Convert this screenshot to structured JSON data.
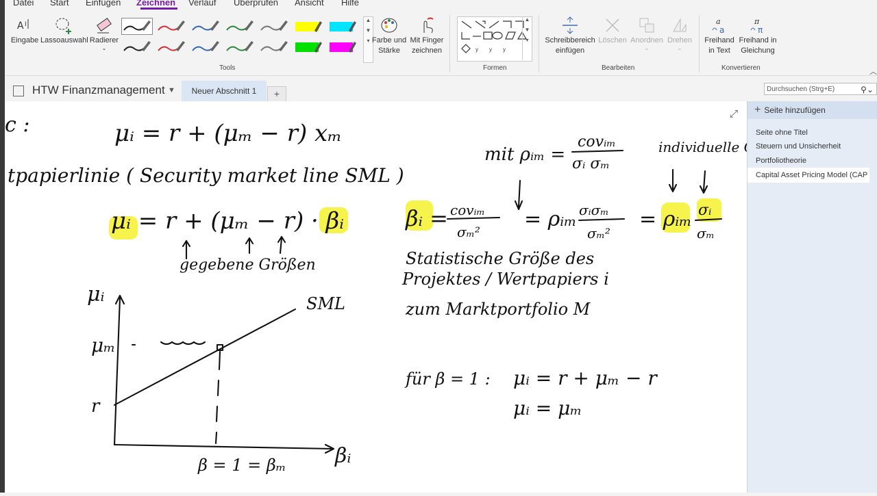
{
  "menu": [
    "Datei",
    "Start",
    "Einfügen",
    "Zeichnen",
    "Verlauf",
    "Überprüfen",
    "Ansicht",
    "Hilfe"
  ],
  "ribbon": {
    "eingabe": "Eingabe",
    "lasso": "Lassoauswahl",
    "radierer": "Radierer",
    "farbe_l1": "Farbe und",
    "farbe_l2": "Stärke",
    "finger_l1": "Mit Finger",
    "finger_l2": "zeichnen",
    "schreib_l1": "Schreibbereich",
    "schreib_l2": "einfügen",
    "loeschen": "Löschen",
    "anordnen": "Anordnen",
    "drehen": "Drehen",
    "freihand_text_l1": "Freihand",
    "freihand_text_l2": "in Text",
    "freihand_gl_l1": "Freihand in",
    "freihand_gl_l2": "Gleichung",
    "groups": {
      "tools": "Tools",
      "formen": "Formen",
      "bearbeiten": "Bearbeiten",
      "konvertieren": "Konvertieren"
    }
  },
  "pen_colors": [
    "#222222",
    "#d13438",
    "#3c6ab0",
    "#2e8b3e",
    "#777777",
    "#ffff00",
    "#00e5ff",
    "#222222",
    "#d13438",
    "#3c6ab0",
    "#2e8b3e",
    "#777777",
    "#00e000",
    "#ff00ff"
  ],
  "notebook": {
    "title": "HTW Finanzmanagement",
    "section": "Neuer Abschnitt 1",
    "add_tab": "+",
    "search_placeholder": "Durchsuchen (Strg+E)"
  },
  "pages": {
    "add_label": "Seite hinzufügen",
    "items": [
      "Seite ohne Titel",
      "Steuern und Unsicherheit",
      "Portfoliotheorie",
      "Capital Asset Pricing Model (CAP"
    ]
  },
  "notes": {
    "line1": "μᵢ = r + (μₘ − r) xₘ",
    "line2": "tpapierlinie ( Security market line  SML )",
    "line3": "μᵢ = r + (μₘ − r) · βᵢ",
    "gegebene": "gegebene Größen",
    "mit": "mit ρᵢₘ =",
    "individuelle": "individuelle Größen",
    "stat1": "Statistische Größe des",
    "stat2": "Projektes / Wertpapiers i",
    "stat3": "zum Marktportfolio M",
    "fuer": "für β = 1 :",
    "eq1": "μᵢ = r + μₘ − r",
    "eq2": "μᵢ = μₘ",
    "axis_y": "μᵢ",
    "axis_x": "βᵢ",
    "label_sml": "SML",
    "label_mum": "μₘ",
    "label_r": "r",
    "label_beta": "β = 1 = βₘ"
  }
}
